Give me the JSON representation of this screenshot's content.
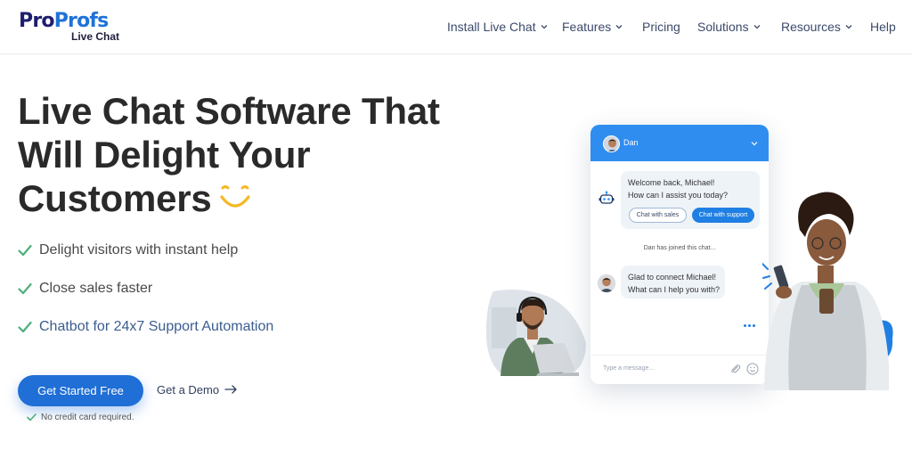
{
  "brand": {
    "logo_pro": "Pro",
    "logo_profs": "Profs",
    "logo_sub": "Live Chat"
  },
  "nav": {
    "items": [
      {
        "label": "Install Live Chat",
        "has_dropdown": true
      },
      {
        "label": "Features",
        "has_dropdown": true
      },
      {
        "label": "Pricing",
        "has_dropdown": false
      },
      {
        "label": "Solutions",
        "has_dropdown": true
      },
      {
        "label": "Resources",
        "has_dropdown": true
      },
      {
        "label": "Help",
        "has_dropdown": false
      }
    ]
  },
  "hero": {
    "title_lines": [
      "Live Chat Software That",
      "Will Delight Your",
      "Customers"
    ],
    "features": [
      "Delight visitors with instant help",
      "Close sales faster",
      "Chatbot for 24x7 Support Automation"
    ],
    "cta_primary": "Get Started Free",
    "cta_secondary": "Get a Demo",
    "cta_note": "No credit card required."
  },
  "chat_widget": {
    "agent_name": "Dan",
    "bot_message": [
      "Welcome back, Michael!",
      "How can I assist you today?"
    ],
    "options": [
      "Chat with sales",
      "Chat with support"
    ],
    "system_message": "Dan has joined this chat...",
    "agent_message": [
      "Glad to connect Michael!",
      "What can I help you with?"
    ],
    "input_placeholder": "Type a message..."
  },
  "colors": {
    "primary": "#1f6fd6",
    "chat_header": "#2f8df0",
    "check": "#4caf7a",
    "smile": "#f5b826",
    "brand_dark": "#1e1e6e",
    "brand_blue": "#1e73d8"
  },
  "icons": {
    "feature_check": "check-icon",
    "demo_arrow": "arrow-right-icon",
    "nav_dropdown": "chevron-down-icon"
  }
}
